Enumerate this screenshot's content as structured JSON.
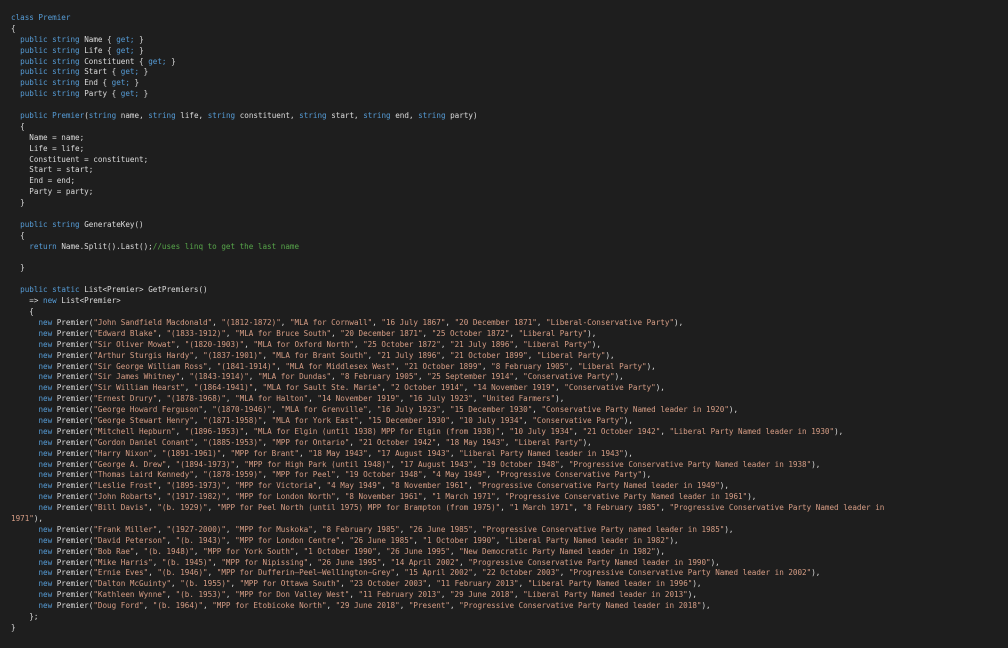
{
  "code": {
    "class_decl": [
      "class",
      " Premier"
    ],
    "open_brace": "{",
    "close_brace": "}",
    "props": [
      {
        "name": "Name"
      },
      {
        "name": "Life"
      },
      {
        "name": "Constituent"
      },
      {
        "name": "Start"
      },
      {
        "name": "End"
      },
      {
        "name": "Party"
      }
    ],
    "kw_public": "public",
    "kw_string": "string",
    "kw_get": "get;",
    "kw_static": "static",
    "kw_new": "new",
    "kw_return": "return",
    "ctor_sig": {
      "name": "Premier(",
      "params": [
        "name",
        "life",
        "constituent",
        "start",
        "end",
        "party"
      ],
      "close": ")"
    },
    "assignments": [
      "Name = name;",
      "Life = life;",
      "Constituent = constituent;",
      "Start = start;",
      "End = end;",
      "Party = party;"
    ],
    "method_genkey": "GenerateKey()",
    "return_expr": "Name.Split().Last();",
    "comment": "//uses linq to get the last name",
    "method_getpremiers": "List<Premier> GetPremiers()",
    "arrow_new": "=> ",
    "list_type": " List<Premier>",
    "end_list": "};",
    "premiers": [
      [
        "\"John Sandfield Macdonald\"",
        "\"(1812-1872)\"",
        "\"MLA for Cornwall\"",
        "\"16 July 1867\"",
        "\"20 December 1871\"",
        "\"Liberal-Conservative Party\""
      ],
      [
        "\"Edward Blake\"",
        "\"(1833-1912)\"",
        "\"MLA for Bruce South\"",
        "\"20 December 1871\"",
        "\"25 October 1872\"",
        "\"Liberal Party\""
      ],
      [
        "\"Sir Oliver Mowat\"",
        "\"(1820-1903)\"",
        "\"MLA for Oxford North\"",
        "\"25 October 1872\"",
        "\"21 July 1896\"",
        "\"Liberal Party\""
      ],
      [
        "\"Arthur Sturgis Hardy\"",
        "\"(1837-1901)\"",
        "\"MLA for Brant South\"",
        "\"21 July 1896\"",
        "\"21 October 1899\"",
        "\"Liberal Party\""
      ],
      [
        "\"Sir George William Ross\"",
        "\"(1841-1914)\"",
        "\"MLA for Middlesex West\"",
        "\"21 October 1899\"",
        "\"8 February 1905\"",
        "\"Liberal Party\""
      ],
      [
        "\"Sir James Whitney\"",
        "\"(1843-1914)\"",
        "\"MLA for Dundas\"",
        "\"8 February 1905\"",
        "\"25 September 1914\"",
        "\"Conservative Party\""
      ],
      [
        "\"Sir William Hearst\"",
        "\"(1864-1941)\"",
        "\"MLA for Sault Ste. Marie\"",
        "\"2 October 1914\"",
        "\"14 November 1919\"",
        "\"Conservative Party\""
      ],
      [
        "\"Ernest Drury\"",
        "\"(1878-1968)\"",
        "\"MLA for Halton\"",
        "\"14 November 1919\"",
        "\"16 July 1923\"",
        "\"United Farmers\""
      ],
      [
        "\"George Howard Ferguson\"",
        "\"(1870-1946)\"",
        "\"MLA for Grenville\"",
        "\"16 July 1923\"",
        "\"15 December 1930\"",
        "\"Conservative Party Named leader in 1920\""
      ],
      [
        "\"George Stewart Henry\"",
        "\"(1871-1958)\"",
        "\"MLA for York East\"",
        "\"15 December 1930\"",
        "\"10 July 1934\"",
        "\"Conservative Party\""
      ],
      [
        "\"Mitchell Hepburn\"",
        "\"(1896-1953)\"",
        "\"MLA for Elgin (until 1938) MPP for Elgin (from 1938)\"",
        "\"10 July 1934\"",
        "\"21 October 1942\"",
        "\"Liberal Party Named leader in 1930\""
      ],
      [
        "\"Gordon Daniel Conant\"",
        "\"(1885-1953)\"",
        "\"MPP for Ontario\"",
        "\"21 October 1942\"",
        "\"18 May 1943\"",
        "\"Liberal Party\""
      ],
      [
        "\"Harry Nixon\"",
        "\"(1891-1961)\"",
        "\"MPP for Brant\"",
        "\"18 May 1943\"",
        "\"17 August 1943\"",
        "\"Liberal Party Named leader in 1943\""
      ],
      [
        "\"George A. Drew\"",
        "\"(1894-1973)\"",
        "\"MPP for High Park (until 1948)\"",
        "\"17 August 1943\"",
        "\"19 October 1948\"",
        "\"Progressive Conservative Party Named leader in 1938\""
      ],
      [
        "\"Thomas Laird Kennedy\"",
        "\"(1878-1959)\"",
        "\"MPP for Peel\"",
        "\"19 October 1948\"",
        "\"4 May 1949\"",
        "\"Progressive Conservative Party\""
      ],
      [
        "\"Leslie Frost\"",
        "\"(1895-1973)\"",
        "\"MPP for Victoria\"",
        "\"4 May 1949\"",
        "\"8 November 1961\"",
        "\"Progressive Conservative Party Named leader in 1949\""
      ],
      [
        "\"John Robarts\"",
        "\"(1917-1982)\"",
        "\"MPP for London North\"",
        "\"8 November 1961\"",
        "\"1 March 1971\"",
        "\"Progressive Conservative Party Named leader in 1961\""
      ],
      [
        "\"Bill Davis\"",
        "\"(b. 1929)\"",
        "\"MPP for Peel North (until 1975) MPP for Brampton (from 1975)\"",
        "\"1 March 1971\"",
        "\"8 February 1985\"",
        "\"Progressive Conservative Party Named leader in 1971\""
      ],
      [
        "\"Frank Miller\"",
        "\"(1927-2000)\"",
        "\"MPP for Muskoka\"",
        "\"8 February 1985\"",
        "\"26 June 1985\"",
        "\"Progressive Conservative Party named leader in 1985\""
      ],
      [
        "\"David Peterson\"",
        "\"(b. 1943)\"",
        "\"MPP for London Centre\"",
        "\"26 June 1985\"",
        "\"1 October 1990\"",
        "\"Liberal Party Named leader in 1982\""
      ],
      [
        "\"Bob Rae\"",
        "\"(b. 1948)\"",
        "\"MPP for York South\"",
        "\"1 October 1990\"",
        "\"26 June 1995\"",
        "\"New Democratic Party Named leader in 1982\""
      ],
      [
        "\"Mike Harris\"",
        "\"(b. 1945)\"",
        "\"MPP for Nipissing\"",
        "\"26 June 1995\"",
        "\"14 April 2002\"",
        "\"Progressive Conservative Party Named leader in 1990\""
      ],
      [
        "\"Ernie Eves\"",
        "\"(b. 1946)\"",
        "\"MPP for Dufferin—Peel—Wellington—Grey\"",
        "\"15 April 2002\"",
        "\"22 October 2003\"",
        "\"Progressive Conservative Party Named leader in 2002\""
      ],
      [
        "\"Dalton McGuinty\"",
        "\"(b. 1955)\"",
        "\"MPP for Ottawa South\"",
        "\"23 October 2003\"",
        "\"11 February 2013\"",
        "\"Liberal Party Named leader in 1996\""
      ],
      [
        "\"Kathleen Wynne\"",
        "\"(b. 1953)\"",
        "\"MPP for Don Valley West\"",
        "\"11 February 2013\"",
        "\"29 June 2018\"",
        "\"Liberal Party Named leader in 2013\""
      ],
      [
        "\"Doug Ford\"",
        "\"(b. 1964)\"",
        "\"MPP for Etobicoke North\"",
        "\"29 June 2018\"",
        "\"Present\"",
        "\"Progressive Conservative Party Named leader in 2018\""
      ]
    ],
    "wrap_row_index": 17,
    "wrap_split": "Progressive Conservative Party Named leader in ",
    "wrap_tail": "1971\"),"
  }
}
